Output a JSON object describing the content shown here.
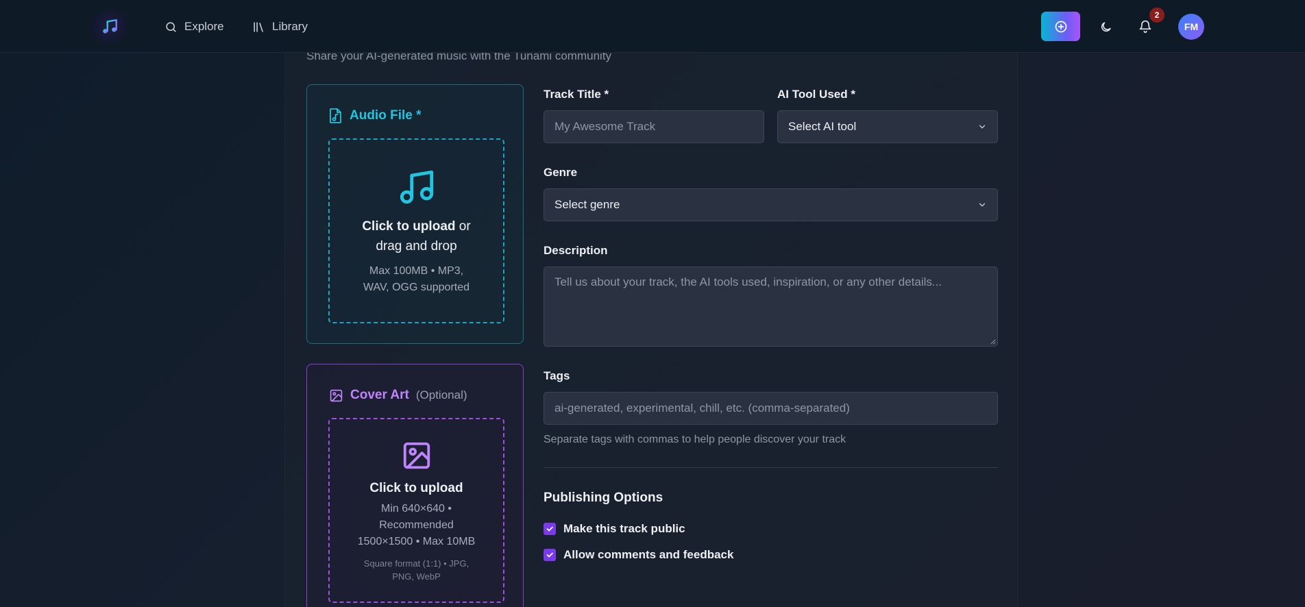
{
  "nav": {
    "explore_label": "Explore",
    "library_label": "Library",
    "notification_count": "2",
    "avatar_initials": "FM",
    "icons": [
      "music-note-icon",
      "search-icon",
      "library-icon",
      "plus-circle-icon",
      "moon-icon",
      "bell-icon"
    ]
  },
  "page": {
    "subtitle": "Share your AI-generated music with the Tunami community"
  },
  "audio_upload": {
    "title": "Audio File *",
    "click_label": "Click to upload",
    "drag_label": " or drag and drop",
    "formats": "Max 100MB • MP3, WAV, OGG supported"
  },
  "cover_upload": {
    "title": "Cover Art",
    "optional_label": "(Optional)",
    "click_label": "Click to upload",
    "size_info": "Min 640×640 • Recommended 1500×1500 • Max 10MB",
    "formats": "Square format (1:1) • JPG, PNG, WebP"
  },
  "form": {
    "track_title_label": "Track Title *",
    "track_title_placeholder": "My Awesome Track",
    "ai_tool_label": "AI Tool Used *",
    "ai_tool_value": "Select AI tool",
    "genre_label": "Genre",
    "genre_value": "Select genre",
    "description_label": "Description",
    "description_placeholder": "Tell us about your track, the AI tools used, inspiration, or any other details...",
    "tags_label": "Tags",
    "tags_placeholder": "ai-generated, experimental, chill, etc. (comma-separated)",
    "tags_hint": "Separate tags with commas to help people discover your track"
  },
  "publishing": {
    "title": "Publishing Options",
    "public_label": "Make this track public",
    "public_checked": true,
    "comments_label": "Allow comments and feedback",
    "comments_checked": true
  },
  "colors": {
    "accent_cyan": "#22c5e0",
    "accent_purple": "#c084fc",
    "checkbox": "#7c3aed",
    "badge": "#8b1d1d"
  }
}
